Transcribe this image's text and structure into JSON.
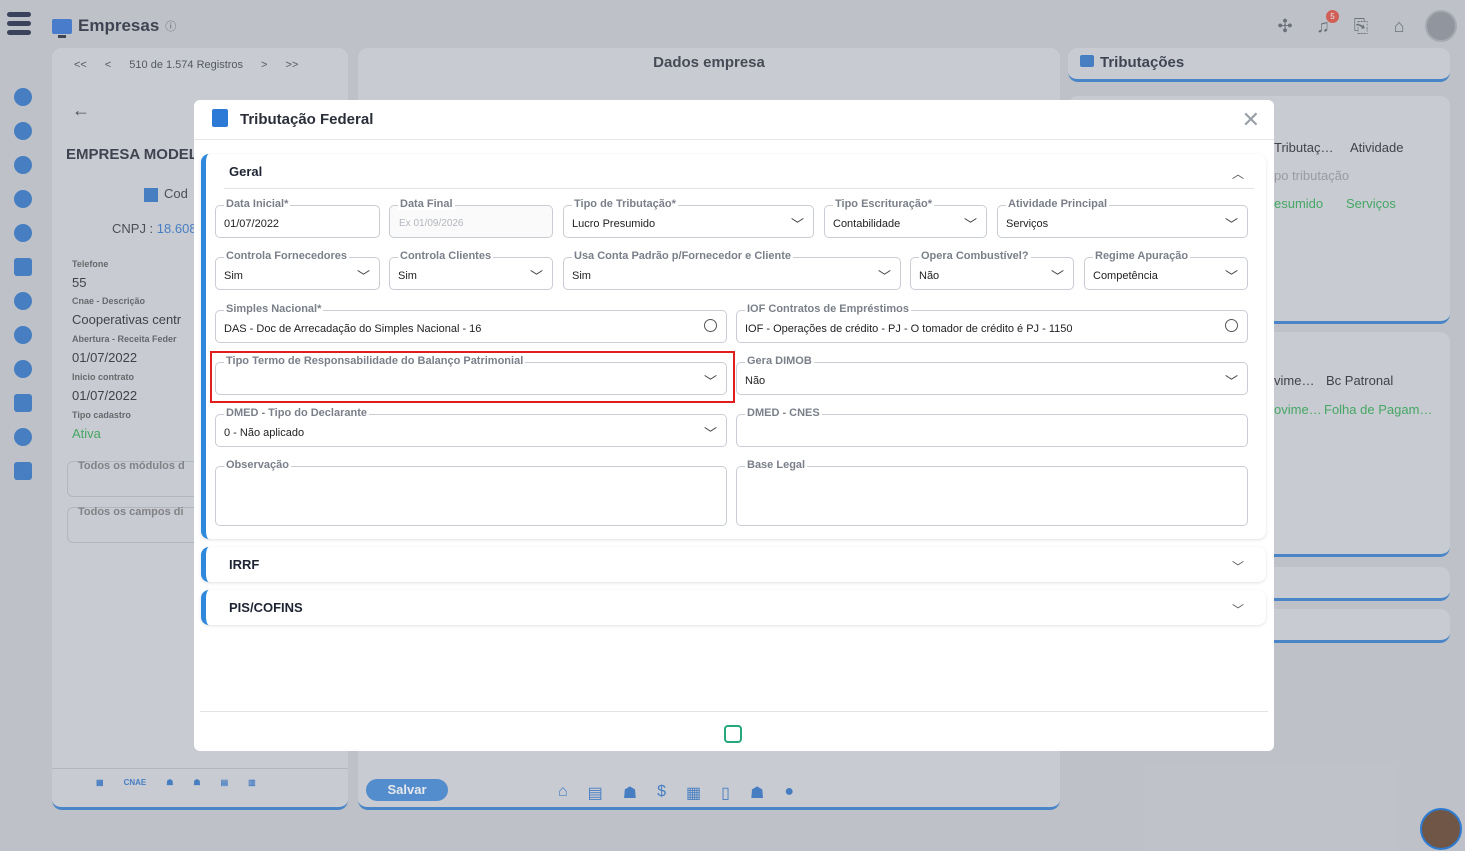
{
  "app": {
    "title": "Empresas",
    "info_icon": "ⓘ",
    "notification_count": "5"
  },
  "left_panel": {
    "nav": {
      "first": "<<",
      "prev": "<",
      "record_text": "510 de 1.574 Registros",
      "next": ">",
      "last": ">>"
    },
    "company_name": "EMPRESA MODEL",
    "code_label": "Cod",
    "cnpj_label": "CNPJ :",
    "cnpj_value": "18.608",
    "fields": [
      {
        "label": "Telefone",
        "value": "55"
      },
      {
        "label": "Cnae - Descrição",
        "value": "Cooperativas centr"
      },
      {
        "label": "Abertura - Receita Feder",
        "value": "01/07/2022"
      },
      {
        "label": "Inicio contrato",
        "value": "01/07/2022"
      },
      {
        "label": "Tipo cadastro",
        "value": "Ativa"
      }
    ],
    "modules_label": "Todos os módulos d",
    "campos_label": "Todos os campos di",
    "bottom_icons": [
      "calendar-icon",
      "CNAE",
      "users-icon",
      "people-icon",
      "list-icon",
      "building-icon"
    ]
  },
  "middle_panel": {
    "title": "Dados empresa",
    "save_label": "Salvar"
  },
  "right_panel": {
    "title": "Tributações",
    "box1": {
      "col1": "Tributaç…",
      "col2": "Atividade",
      "placeholder": "po tributação",
      "val1": "esumido",
      "val2": "Serviços"
    },
    "box2": {
      "col1": "vime…",
      "col2": "Bc Patronal",
      "val1": "ovime…",
      "val2": "Folha de Pagam…"
    }
  },
  "modal": {
    "title": "Tributação Federal",
    "sections": {
      "geral": "Geral",
      "irrf": "IRRF",
      "pis": "PIS/COFINS"
    },
    "fields": {
      "data_inicial": {
        "label": "Data Inicial*",
        "value": "01/07/2022"
      },
      "data_final": {
        "label": "Data Final",
        "placeholder": "Ex 01/09/2026"
      },
      "tipo_tributacao": {
        "label": "Tipo de Tributação*",
        "value": "Lucro Presumido"
      },
      "tipo_escrituracao": {
        "label": "Tipo Escrituração*",
        "value": "Contabilidade"
      },
      "atividade_principal": {
        "label": "Atividade Principal",
        "value": "Serviços"
      },
      "controla_fornecedores": {
        "label": "Controla Fornecedores",
        "value": "Sim"
      },
      "controla_clientes": {
        "label": "Controla Clientes",
        "value": "Sim"
      },
      "usa_conta_padrao": {
        "label": "Usa Conta Padrão p/Fornecedor e Cliente",
        "value": "Sim"
      },
      "opera_combustivel": {
        "label": "Opera Combustível?",
        "value": "Não"
      },
      "regime_apuracao": {
        "label": "Regime Apuração",
        "value": "Competência"
      },
      "simples_nacional": {
        "label": "Simples Nacional*",
        "value": "DAS - Doc de Arrecadação do Simples Nacional - 16"
      },
      "iof": {
        "label": "IOF Contratos de Empréstimos",
        "value": "IOF - Operações de crédito - PJ - O tomador de crédito é PJ - 1150"
      },
      "tipo_termo": {
        "label": "Tipo Termo de Responsabilidade do Balanço Patrimonial",
        "value": ""
      },
      "gera_dimob": {
        "label": "Gera DIMOB",
        "value": "Não"
      },
      "dmed_tipo": {
        "label": "DMED - Tipo do Declarante",
        "value": "0 - Não aplicado"
      },
      "dmed_cnes": {
        "label": "DMED - CNES",
        "value": ""
      },
      "observacao": {
        "label": "Observação",
        "value": ""
      },
      "base_legal": {
        "label": "Base Legal",
        "value": ""
      }
    }
  },
  "colors": {
    "accent": "#2e88db",
    "highlight": "#e01e1e",
    "green": "#27a87a"
  }
}
